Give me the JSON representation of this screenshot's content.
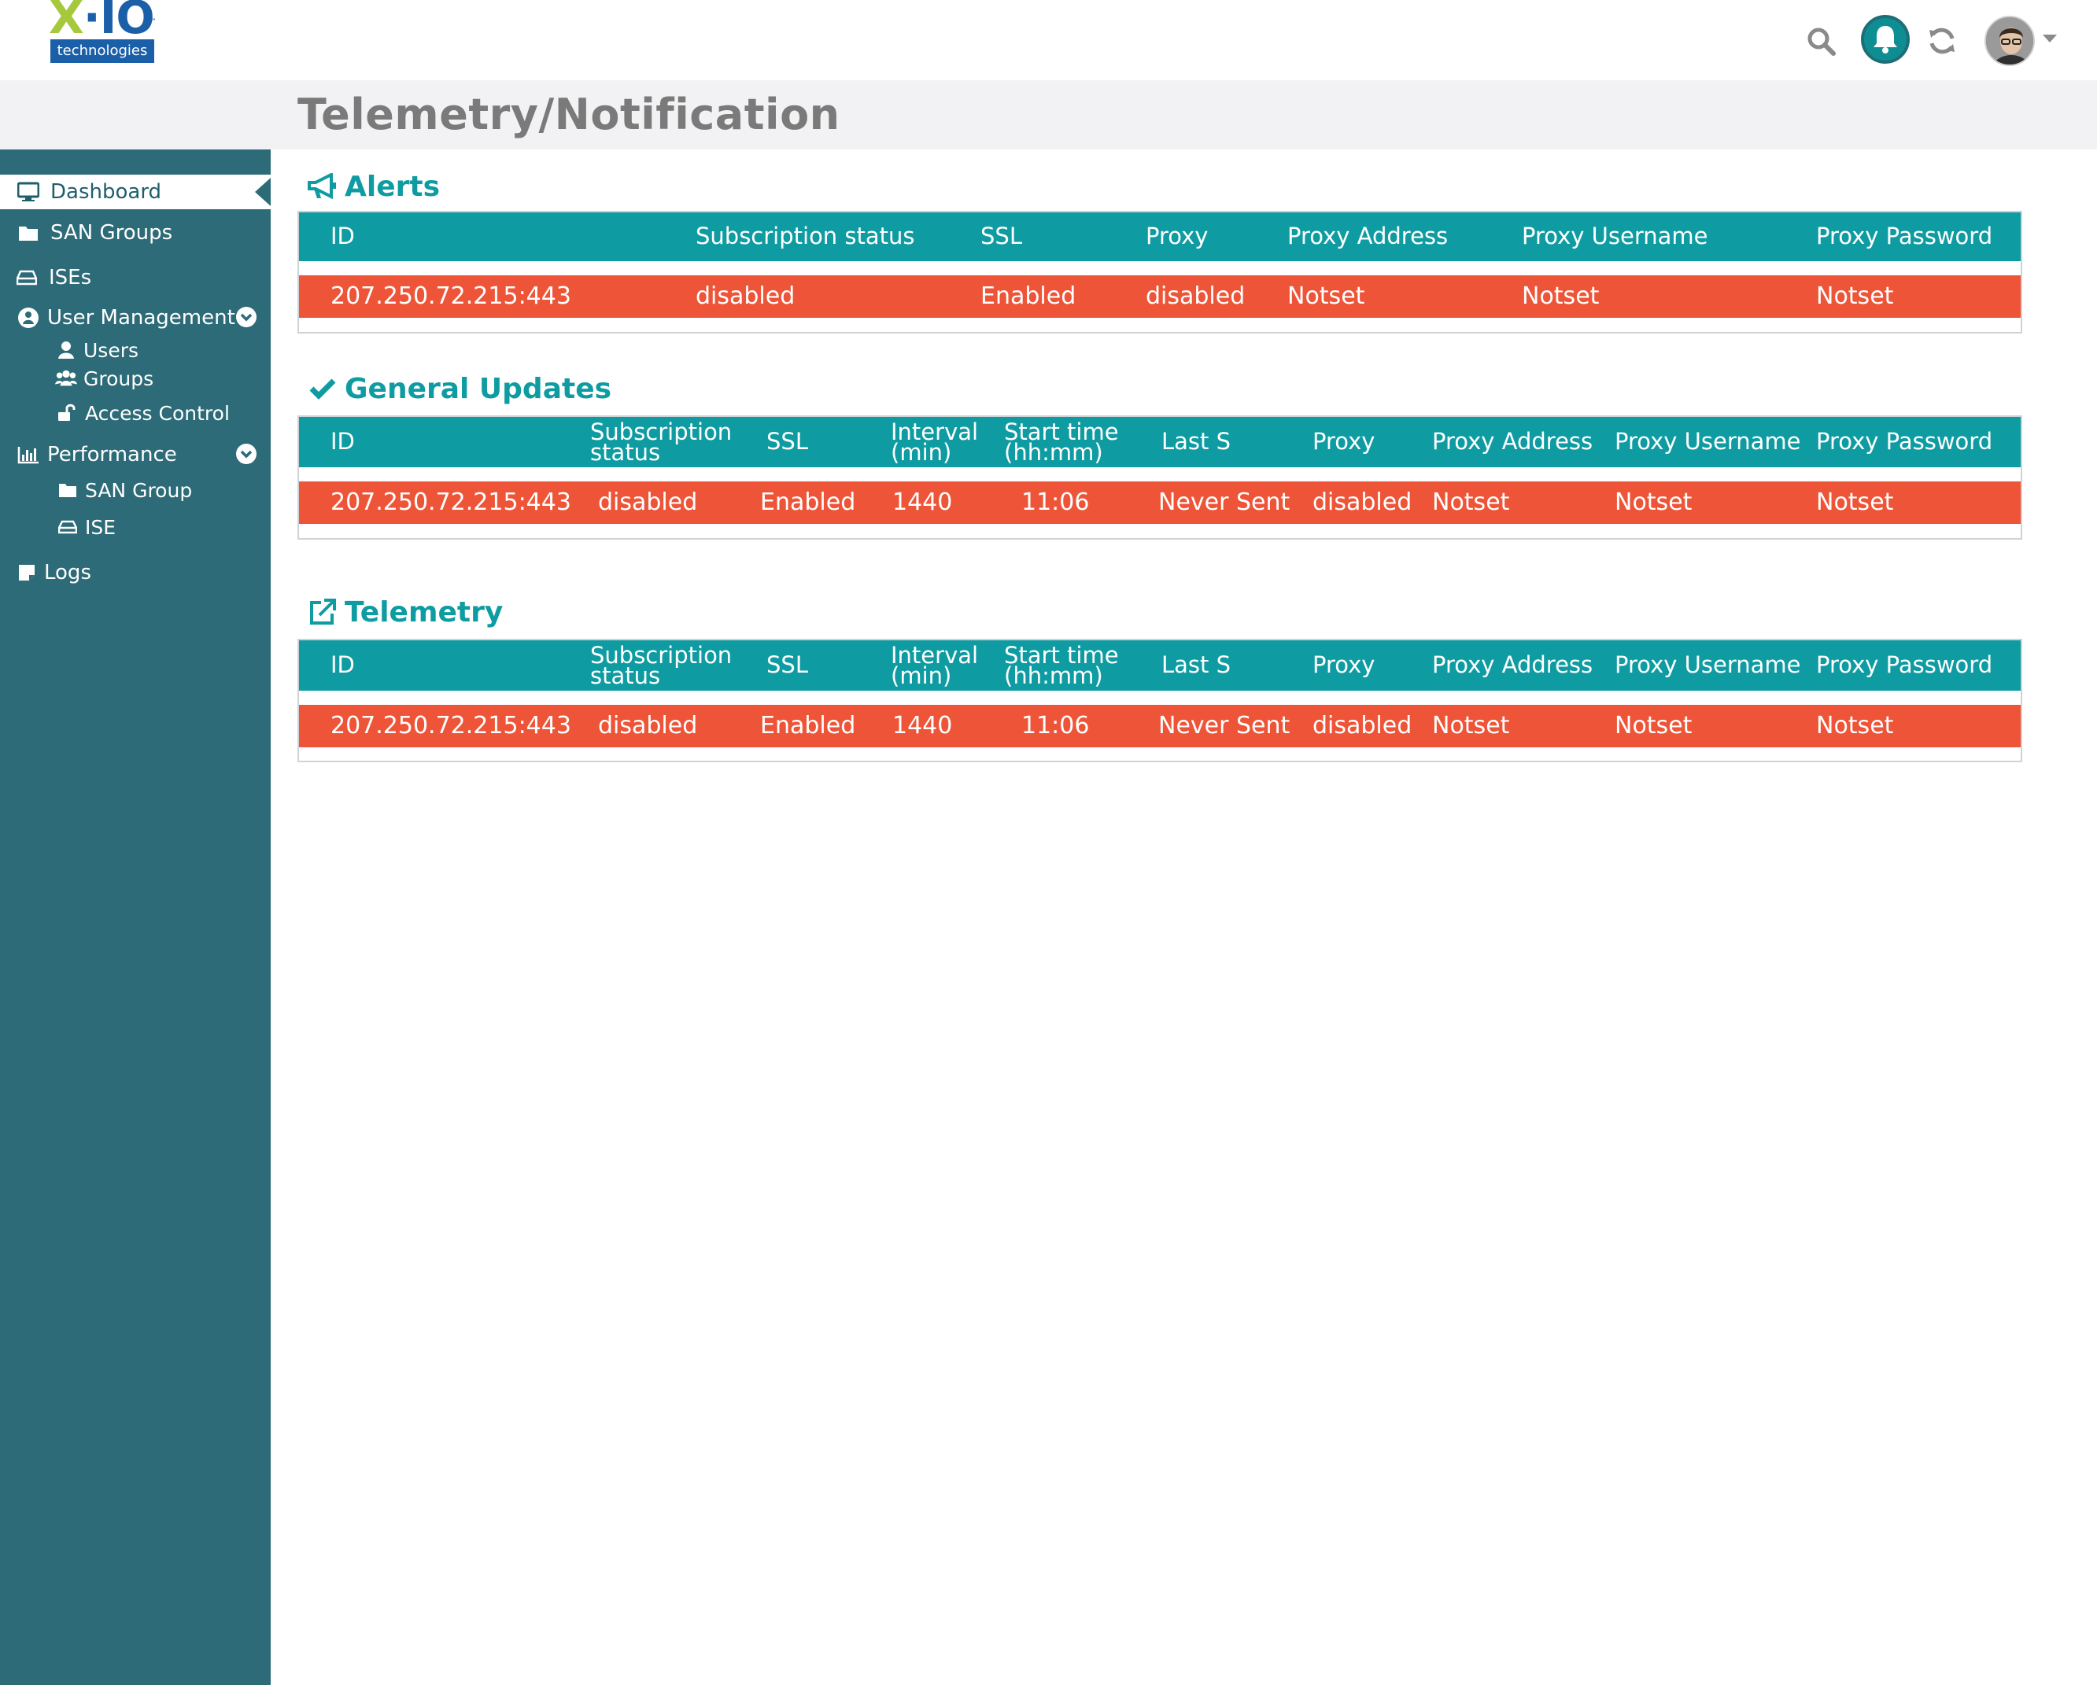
{
  "brand": {
    "logo_main": "X·IO",
    "logo_sub": "technologies",
    "logo_tm": "™"
  },
  "header": {
    "icons": [
      "search-icon",
      "bell-icon",
      "refresh-icon",
      "avatar",
      "caret-down-icon"
    ]
  },
  "page": {
    "title": "Telemetry/Notification"
  },
  "sidebar": {
    "items": [
      {
        "label": "Dashboard",
        "icon": "monitor-icon",
        "active": true
      },
      {
        "label": "SAN Groups",
        "icon": "folder-icon"
      },
      {
        "label": "ISEs",
        "icon": "drive-icon"
      },
      {
        "label": "User Management",
        "icon": "user-circle-icon",
        "expandable": true
      },
      {
        "label": "Users",
        "icon": "user-icon",
        "child": true
      },
      {
        "label": "Groups",
        "icon": "users-icon",
        "child": true
      },
      {
        "label": "Access Control",
        "icon": "unlock-icon",
        "child": true
      },
      {
        "label": "Performance",
        "icon": "bar-chart-icon",
        "expandable": true
      },
      {
        "label": "SAN Group",
        "icon": "folder-icon",
        "child": true
      },
      {
        "label": "ISE",
        "icon": "drive-icon",
        "child": true
      },
      {
        "label": "Logs",
        "icon": "note-icon"
      }
    ]
  },
  "sections": {
    "alerts": {
      "title": "Alerts",
      "headers": [
        "ID",
        "Subscription status",
        "SSL",
        "Proxy",
        "Proxy Address",
        "Proxy Username",
        "Proxy Password"
      ],
      "row": [
        "207.250.72.215:443",
        "disabled",
        "Enabled",
        "disabled",
        "Notset",
        "Notset",
        "Notset"
      ]
    },
    "general": {
      "title": "General Updates",
      "headers": [
        "ID",
        "Subscription\nstatus",
        "SSL",
        "Interval\n(min)",
        "Start time\n(hh:mm)",
        "Last S",
        "Proxy",
        "Proxy Address",
        "Proxy Username",
        "Proxy Password"
      ],
      "row": [
        "207.250.72.215:443",
        "disabled",
        "Enabled",
        "1440",
        "11:06",
        "Never Sent",
        "disabled",
        "Notset",
        "Notset",
        "Notset"
      ]
    },
    "telemetry": {
      "title": "Telemetry",
      "headers": [
        "ID",
        "Subscription\nstatus",
        "SSL",
        "Interval\n(min)",
        "Start time\n(hh:mm)",
        "Last S",
        "Proxy",
        "Proxy Address",
        "Proxy Username",
        "Proxy Password"
      ],
      "row": [
        "207.250.72.215:443",
        "disabled",
        "Enabled",
        "1440",
        "11:06",
        "Never Sent",
        "disabled",
        "Notset",
        "Notset",
        "Notset"
      ]
    }
  },
  "colors": {
    "teal": "#0e9ca2",
    "sidebar": "#2c6b77",
    "alert_row": "#ee5538",
    "title_band": "#f2f2f4"
  }
}
